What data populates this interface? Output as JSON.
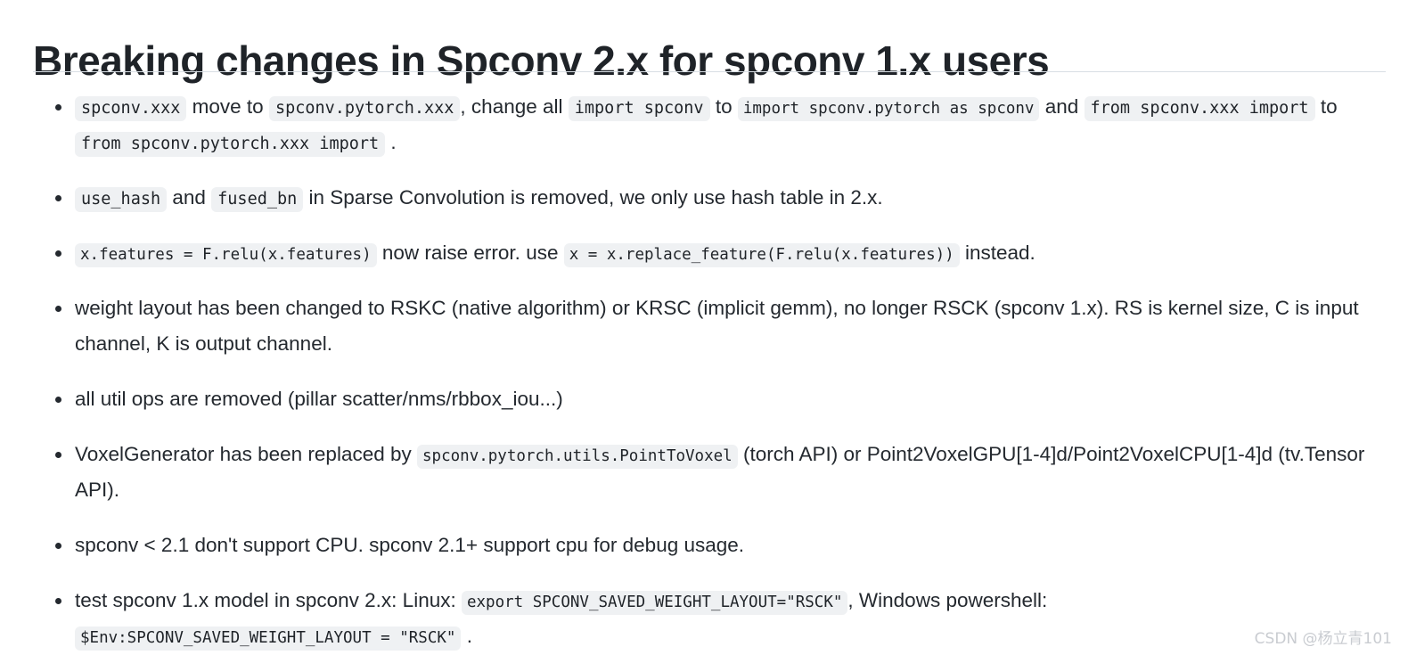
{
  "document": {
    "title": "Breaking changes in Spconv 2.x for spconv 1.x users",
    "bullets": [
      {
        "id": "module-path-change",
        "parts": [
          {
            "type": "code",
            "text": "spconv.xxx"
          },
          {
            "type": "text",
            "text": " move to "
          },
          {
            "type": "code",
            "text": "spconv.pytorch.xxx"
          },
          {
            "type": "text",
            "text": ", change all "
          },
          {
            "type": "code",
            "text": "import spconv"
          },
          {
            "type": "text",
            "text": " to "
          },
          {
            "type": "code",
            "text": "import spconv.pytorch as spconv"
          },
          {
            "type": "text",
            "text": " and "
          },
          {
            "type": "code",
            "text": "from spconv.xxx import"
          },
          {
            "type": "text",
            "text": " to "
          },
          {
            "type": "code",
            "text": "from spconv.pytorch.xxx import"
          },
          {
            "type": "text",
            "text": " ."
          }
        ]
      },
      {
        "id": "use-hash-fused-bn-removed",
        "parts": [
          {
            "type": "code",
            "text": "use_hash"
          },
          {
            "type": "text",
            "text": " and "
          },
          {
            "type": "code",
            "text": "fused_bn"
          },
          {
            "type": "text",
            "text": " in Sparse Convolution is removed, we only use hash table in 2.x."
          }
        ]
      },
      {
        "id": "replace-feature",
        "parts": [
          {
            "type": "code",
            "text": "x.features = F.relu(x.features)"
          },
          {
            "type": "text",
            "text": " now raise error. use "
          },
          {
            "type": "code",
            "text": "x = x.replace_feature(F.relu(x.features))"
          },
          {
            "type": "text",
            "text": " instead."
          }
        ]
      },
      {
        "id": "weight-layout",
        "parts": [
          {
            "type": "text",
            "text": "weight layout has been changed to RSKC (native algorithm) or KRSC (implicit gemm), no longer RSCK (spconv 1.x). RS is kernel size, C is input channel, K is output channel."
          }
        ]
      },
      {
        "id": "util-ops-removed",
        "parts": [
          {
            "type": "text",
            "text": "all util ops are removed (pillar scatter/nms/rbbox_iou...)"
          }
        ]
      },
      {
        "id": "voxel-generator-replaced",
        "parts": [
          {
            "type": "text",
            "text": "VoxelGenerator has been replaced by "
          },
          {
            "type": "code",
            "text": "spconv.pytorch.utils.PointToVoxel"
          },
          {
            "type": "text",
            "text": " (torch API) or Point2VoxelGPU[1-4]d/Point2VoxelCPU[1-4]d (tv.Tensor API)."
          }
        ]
      },
      {
        "id": "cpu-support",
        "parts": [
          {
            "type": "text",
            "text": "spconv < 2.1 don't support CPU. spconv 2.1+ support cpu for debug usage."
          }
        ]
      },
      {
        "id": "saved-weight-layout",
        "parts": [
          {
            "type": "text",
            "text": "test spconv 1.x model in spconv 2.x: Linux: "
          },
          {
            "type": "code",
            "text": "export SPCONV_SAVED_WEIGHT_LAYOUT=\"RSCK\""
          },
          {
            "type": "text",
            "text": ", Windows powershell: "
          },
          {
            "type": "code",
            "text": "$Env:SPCONV_SAVED_WEIGHT_LAYOUT = \"RSCK\""
          },
          {
            "type": "text",
            "text": " ."
          }
        ]
      }
    ]
  },
  "watermark": {
    "text": "CSDN @杨立青101"
  },
  "colors": {
    "text": "#24292f",
    "title": "#1f2328",
    "rule": "#d8dee4",
    "code_bg": "#eff1f3",
    "watermark": "#c9ccd1",
    "page_bg": "#ffffff"
  }
}
